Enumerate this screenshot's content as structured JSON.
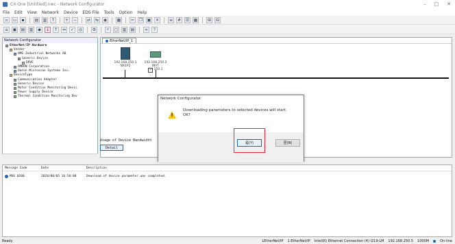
{
  "window": {
    "title": "CX-One [Untitled].nwc - Network Configurator"
  },
  "menu": [
    "File",
    "Edit",
    "View",
    "Network",
    "Device",
    "EDS File",
    "Tools",
    "Option",
    "Help"
  ],
  "tree": {
    "header": "Network Configurator",
    "items": [
      {
        "label": "EtherNet/IP Hardware",
        "bold": true
      },
      {
        "label": "Vendor"
      },
      {
        "label": "HMS Industrial Networks AB"
      },
      {
        "label": "Generic Device"
      },
      {
        "label": "DRVE"
      },
      {
        "label": "OMRON Corporation"
      },
      {
        "label": "Omron Microscan Systems Inc."
      },
      {
        "label": "DeviceType"
      },
      {
        "label": "Communication Adapter"
      },
      {
        "label": "Generic Device"
      },
      {
        "label": "Motor Condition Monitoring Devic"
      },
      {
        "label": "Power Supply Device"
      },
      {
        "label": "Thermal Condition Monitoring Dev"
      }
    ]
  },
  "tab": {
    "label": "EtherNet/IP_1"
  },
  "devices": [
    {
      "ip": "192.168.250.1",
      "name": "NX1P2"
    },
    {
      "ip": "192.168.250.2",
      "name": "INVT",
      "sub": "250.1"
    }
  ],
  "bandwidth": {
    "label": "Usage of Device Bandwidth",
    "button": "Detail"
  },
  "log": {
    "columns": [
      "Message Code",
      "Date",
      "Description"
    ],
    "rows": [
      {
        "code": "MSG 0200",
        "date": "2020/08/05 16:50:08",
        "desc": "Download of device parameter was completed."
      }
    ]
  },
  "dialog": {
    "title": "Network Configurator",
    "line1": "Downloading parameters to selected devices will start.",
    "line2": "OK?",
    "yes": "是(Y)",
    "no": "否(N)"
  },
  "status": {
    "left": "Ready",
    "right": [
      "LEtherNet/IP",
      "1:EtherNet/IP",
      "Intel(R) Ethernet Connection (4) I219-LM",
      "192.168.250.5",
      "1000M",
      "On-line"
    ]
  }
}
